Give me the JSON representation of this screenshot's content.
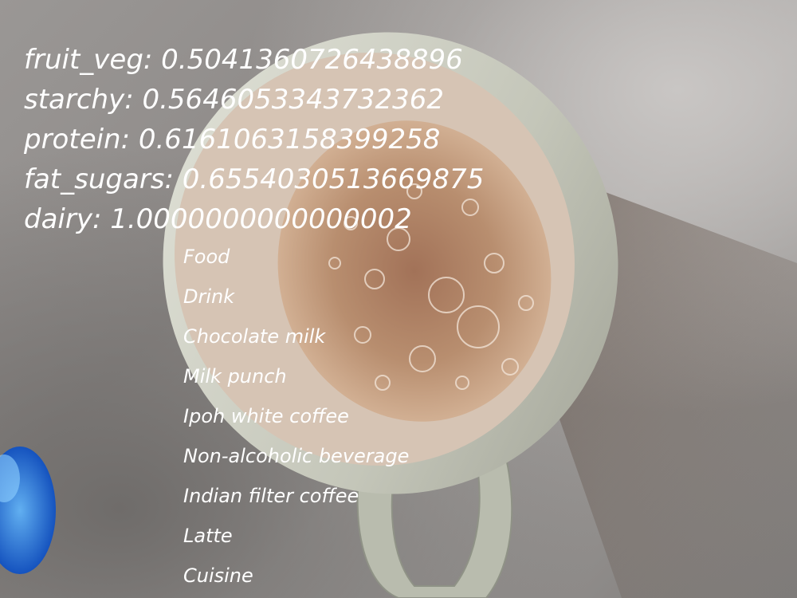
{
  "scores": [
    {
      "label": "fruit_veg",
      "value": "0.5041360726438896"
    },
    {
      "label": "starchy",
      "value": "0.5646053343732362"
    },
    {
      "label": "protein",
      "value": "0.6161063158399258"
    },
    {
      "label": "fat_sugars",
      "value": "0.6554030513669875"
    },
    {
      "label": "dairy",
      "value": "1.0000000000000002"
    }
  ],
  "scores_text": [
    "fruit_veg: 0.5041360726438896",
    "starchy: 0.5646053343732362",
    "protein: 0.6161063158399258",
    "fat_sugars: 0.6554030513669875",
    "dairy: 1.0000000000000002"
  ],
  "tags": [
    "Food",
    "Drink",
    "Chocolate milk",
    "Milk punch",
    "Ipoh white coffee",
    "Non-alcoholic beverage",
    "Indian filter coffee",
    "Latte",
    "Cuisine"
  ],
  "colors": {
    "overlay_text": "#ffffff",
    "table_surface": "#9a9795",
    "mug_ceramic": "#c8c9bd",
    "drink": "#b58a6a"
  }
}
